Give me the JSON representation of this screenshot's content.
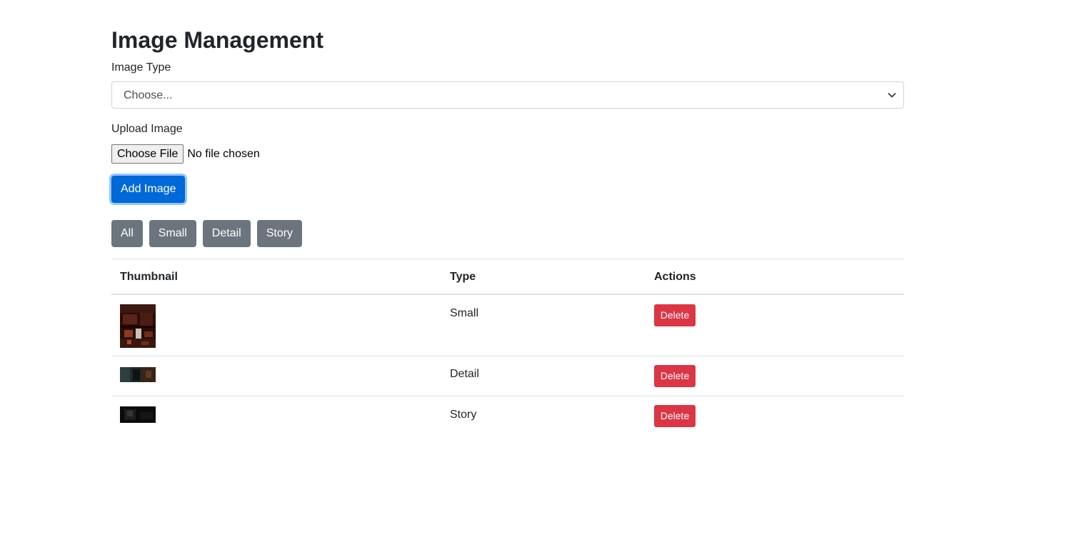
{
  "page": {
    "title": "Image Management"
  },
  "form": {
    "image_type_label": "Image Type",
    "image_type_selected": "Choose...",
    "upload_label": "Upload Image",
    "file_button_label": "Choose File",
    "file_status": "No file chosen",
    "submit_label": "Add Image"
  },
  "filters": [
    "All",
    "Small",
    "Detail",
    "Story"
  ],
  "table": {
    "headers": [
      "Thumbnail",
      "Type",
      "Actions"
    ],
    "rows": [
      {
        "type": "Small",
        "action": "Delete"
      },
      {
        "type": "Detail",
        "action": "Delete"
      },
      {
        "type": "Story",
        "action": "Delete"
      }
    ]
  },
  "colors": {
    "primary": "#0069d9",
    "secondary": "#6c757d",
    "danger": "#dc3545"
  }
}
